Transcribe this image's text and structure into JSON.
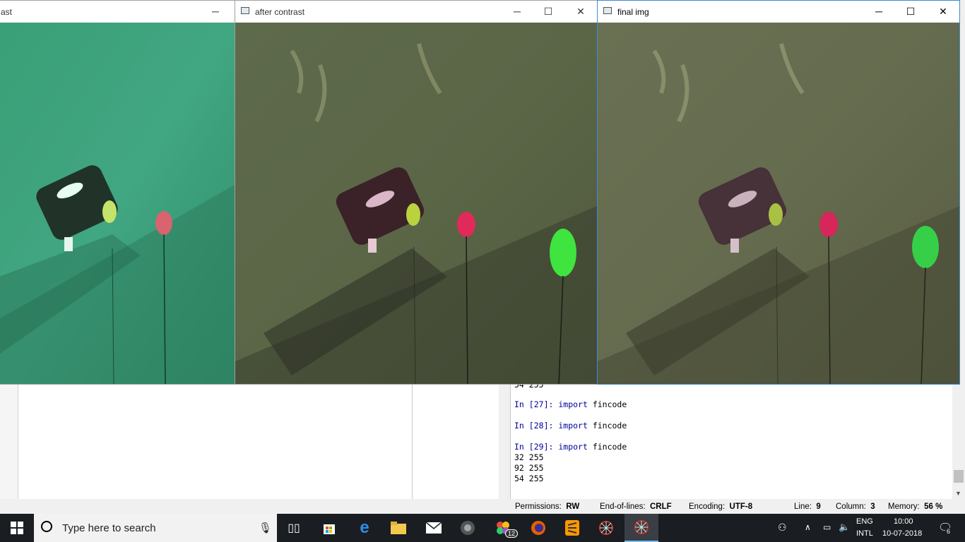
{
  "windows": {
    "left": {
      "title_fragment": "ast"
    },
    "middle": {
      "title": "after contrast"
    },
    "right": {
      "title": "final img"
    }
  },
  "controls": {
    "minimize": "─",
    "maximize": "☐",
    "close": "✕"
  },
  "console": {
    "lines": [
      {
        "prompt": "In [",
        "num": "27",
        "close": "]: ",
        "kw": "import",
        "text": " fincode"
      },
      {
        "prompt": "In [",
        "num": "28",
        "close": "]: ",
        "kw": "import",
        "text": " fincode"
      },
      {
        "prompt": "In [",
        "num": "29",
        "close": "]: ",
        "kw": "import",
        "text": " fincode"
      }
    ],
    "top_fragment": "54 255",
    "output": [
      "32 255",
      "92 255",
      "54 255"
    ]
  },
  "statusbar": {
    "permissions_label": "Permissions:",
    "permissions_value": "RW",
    "eol_label": "End-of-lines:",
    "eol_value": "CRLF",
    "encoding_label": "Encoding:",
    "encoding_value": "UTF-8",
    "line_label": "Line:",
    "line_value": "9",
    "column_label": "Column:",
    "column_value": "3",
    "memory_label": "Memory:",
    "memory_value": "56 %"
  },
  "taskbar": {
    "search_placeholder": "Type here to search",
    "mail_badge": "12",
    "language": "ENG",
    "layout": "INTL",
    "time": "10:00",
    "date": "10-07-2018",
    "notification_count": "6"
  },
  "colors": {
    "taskbar": "#1a1d22",
    "accent": "#0078d7"
  }
}
